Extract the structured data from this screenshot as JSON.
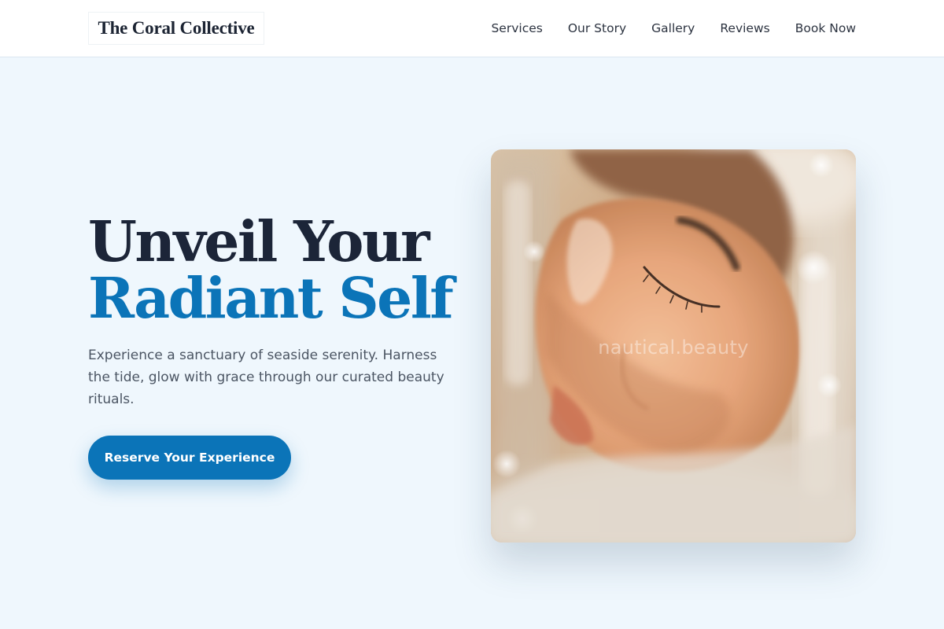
{
  "header": {
    "logo": "The Coral Collective",
    "nav": [
      {
        "label": "Services"
      },
      {
        "label": "Our Story"
      },
      {
        "label": "Gallery"
      },
      {
        "label": "Reviews"
      },
      {
        "label": "Book Now"
      }
    ]
  },
  "hero": {
    "title_line1": "Unveil Your",
    "title_line2": "Radiant Self",
    "description": "Experience a sanctuary of seaside serenity. Harness the tide, glow with grace through our curated beauty rituals.",
    "cta_label": "Reserve Your Experience",
    "image_watermark": "nautical.beauty"
  },
  "colors": {
    "accent": "#0b74b8",
    "heading": "#1c2538",
    "page_background": "#eff7fd",
    "header_background": "#ffffff"
  }
}
